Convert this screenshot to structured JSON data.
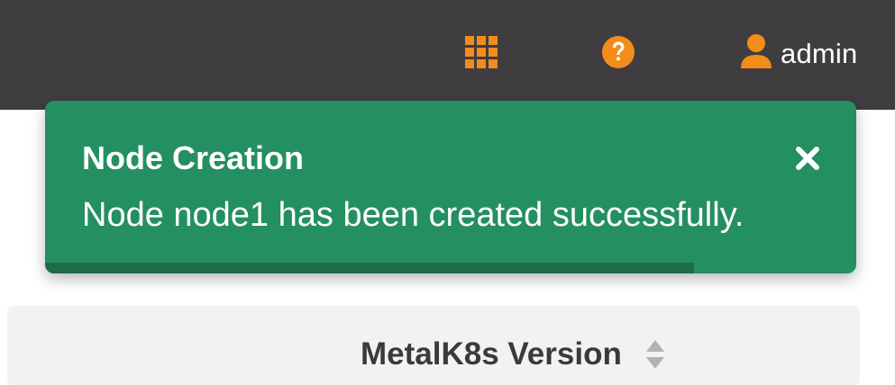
{
  "navbar": {
    "apps_icon": "apps-grid-icon",
    "help_icon": "help-circle-icon",
    "user_icon": "user-icon",
    "user_label": "admin",
    "accent_color": "#f28c1b",
    "background_color": "#3f3d40"
  },
  "toast": {
    "title": "Node Creation",
    "message": "Node node1 has been created successfully.",
    "close_icon": "close-icon",
    "background_color": "#248f60",
    "progress_fraction": 0.8
  },
  "table": {
    "column_header": "MetalK8s Version",
    "sort_icon": "sort-icon"
  }
}
